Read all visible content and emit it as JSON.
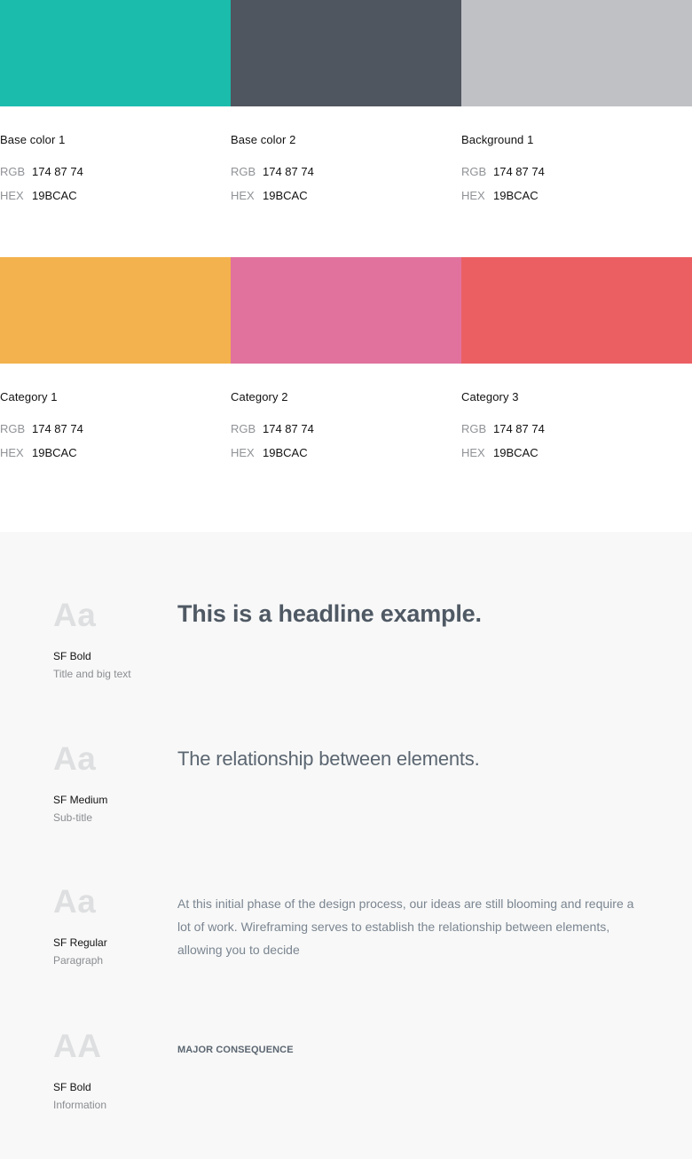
{
  "palette": [
    {
      "name": "Base color 1",
      "color": "#1bbcac",
      "rgb_label": "RGB",
      "rgb": "174 87 74",
      "hex_label": "HEX",
      "hex": "19BCAC"
    },
    {
      "name": "Base color 2",
      "color": "#50565f",
      "rgb_label": "RGB",
      "rgb": "174 87 74",
      "hex_label": "HEX",
      "hex": "19BCAC"
    },
    {
      "name": "Background 1",
      "color": "#bfc1c5",
      "rgb_label": "RGB",
      "rgb": "174 87 74",
      "hex_label": "HEX",
      "hex": "19BCAC"
    },
    {
      "name": "Category 1",
      "color": "#f3b24d",
      "rgb_label": "RGB",
      "rgb": "174 87 74",
      "hex_label": "HEX",
      "hex": "19BCAC"
    },
    {
      "name": "Category 2",
      "color": "#e1729e",
      "rgb_label": "RGB",
      "rgb": "174 87 74",
      "hex_label": "HEX",
      "hex": "19BCAC"
    },
    {
      "name": "Category 3",
      "color": "#eb5f63",
      "rgb_label": "RGB",
      "rgb": "174 87 74",
      "hex_label": "HEX",
      "hex": "19BCAC"
    }
  ],
  "typography": [
    {
      "sample": "Aa",
      "font": "SF Bold",
      "usage": "Title and big text",
      "example": "This is a headline example."
    },
    {
      "sample": "Aa",
      "font": "SF Medium",
      "usage": "Sub-title",
      "example": "The relationship between elements."
    },
    {
      "sample": "Aa",
      "font": "SF Regular",
      "usage": "Paragraph",
      "example": "At this initial phase of the design process, our ideas are still blooming and require a lot of work. Wireframing serves to establish the relationship between elements, allowing you to decide"
    },
    {
      "sample": "AA",
      "font": "SF Bold",
      "usage": "Information",
      "example": "MAJOR CONSEQUENCE"
    }
  ]
}
